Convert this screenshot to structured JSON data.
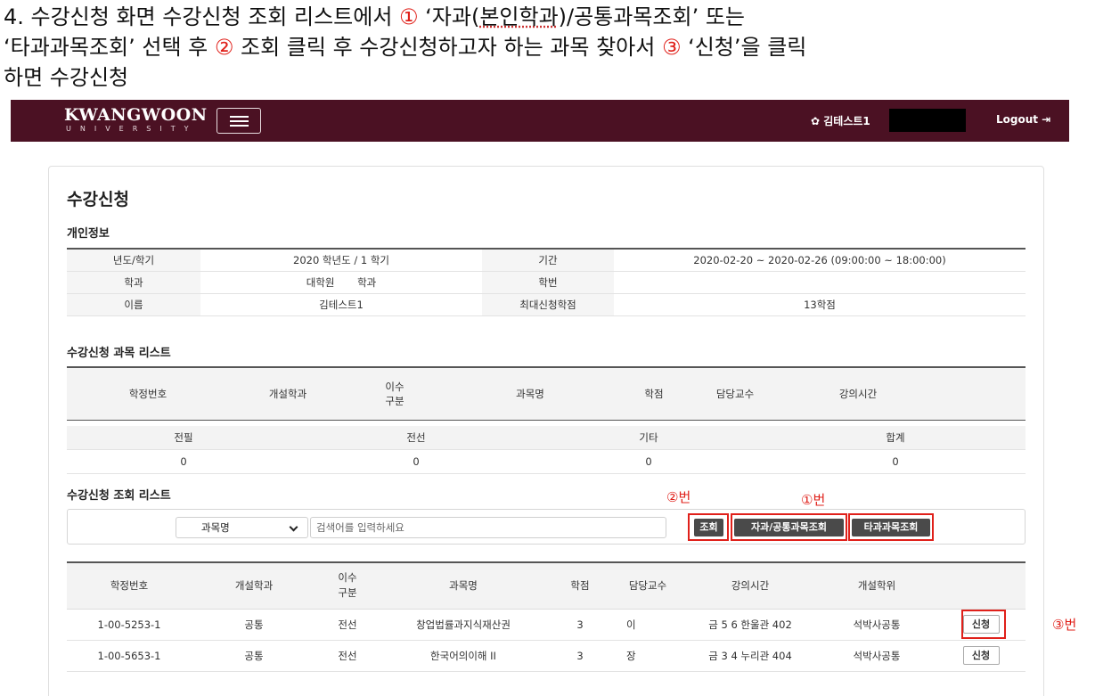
{
  "caption": {
    "line1_a": "4. 수강신청 화면 수강신청 조회 리스트에서 ",
    "mark1": "①",
    "line1_b": " ‘자과(",
    "line1_ul": "본인학과",
    "line1_c": ")/공통과목조회’ 또는",
    "line2_a": "‘타과과목조회’ 선택 후 ",
    "mark2": "②",
    "line2_b": " 조회 클릭 후 수강신청하고자 하는 과목 찾아서 ",
    "mark3": "③",
    "line2_c": " ‘신청’을 클릭",
    "line3": "하면 수강신청"
  },
  "header": {
    "logo": "KWANGWOON",
    "logo_sub": "UNIVERSITY",
    "user": "✿ 김테스트1",
    "logout": "Logout ⇥"
  },
  "page": {
    "title": "수강신청",
    "personal_title": "개인정보",
    "course_list_title": "수강신청 과목 리스트",
    "search_list_title": "수강신청 조회 리스트"
  },
  "info": {
    "year_label": "년도/학기",
    "year_value": "2020 학년도 / 1 학기",
    "period_label": "기간",
    "period_value": "2020-02-20 ~ 2020-02-26 (09:00:00 ~ 18:00:00)",
    "dept_label": "학과",
    "dept_value": "대학원       학과",
    "id_label": "학번",
    "id_value": "",
    "name_label": "이름",
    "name_value": "김테스트1",
    "max_label": "최대신청학점",
    "max_value": "13학점"
  },
  "course_head": {
    "no": "학정번호",
    "dept": "개설학과",
    "type1": "이수",
    "type2": "구분",
    "name": "과목명",
    "credit": "학점",
    "prof": "담당교수",
    "time": "강의시간"
  },
  "summary": {
    "headers": [
      "전필",
      "전선",
      "기타",
      "합계"
    ],
    "values": [
      "0",
      "0",
      "0",
      "0"
    ]
  },
  "search": {
    "select_value": "과목명",
    "placeholder": "검색어를 입력하세요",
    "btn_query": "조회",
    "btn_own": "자과/공통과목조회",
    "btn_other": "타과과목조회"
  },
  "annotations": {
    "a2": "②번",
    "a1": "①번",
    "a3": "③번"
  },
  "list_head": {
    "no": "학정번호",
    "dept": "개설학과",
    "type1": "이수",
    "type2": "구분",
    "name": "과목명",
    "credit": "학점",
    "prof": "담당교수",
    "time": "강의시간",
    "degree": "개설학위"
  },
  "rows": [
    {
      "no": "1-00-5253-1",
      "dept": "공통",
      "type": "전선",
      "name": "창업법률과지식재산권",
      "credit": "3",
      "prof": "이",
      "time": "금 5 6 한울관 402",
      "degree": "석박사공통",
      "apply": "신청"
    },
    {
      "no": "1-00-5653-1",
      "dept": "공통",
      "type": "전선",
      "name": "한국어의이해 II",
      "credit": "3",
      "prof": "장",
      "time": "금 3 4 누리관 404",
      "degree": "석박사공통",
      "apply": "신청"
    }
  ],
  "colors": {
    "header_bg": "#4b1123",
    "annotation": "#e0201a",
    "dark_button": "#4a4a4a"
  }
}
